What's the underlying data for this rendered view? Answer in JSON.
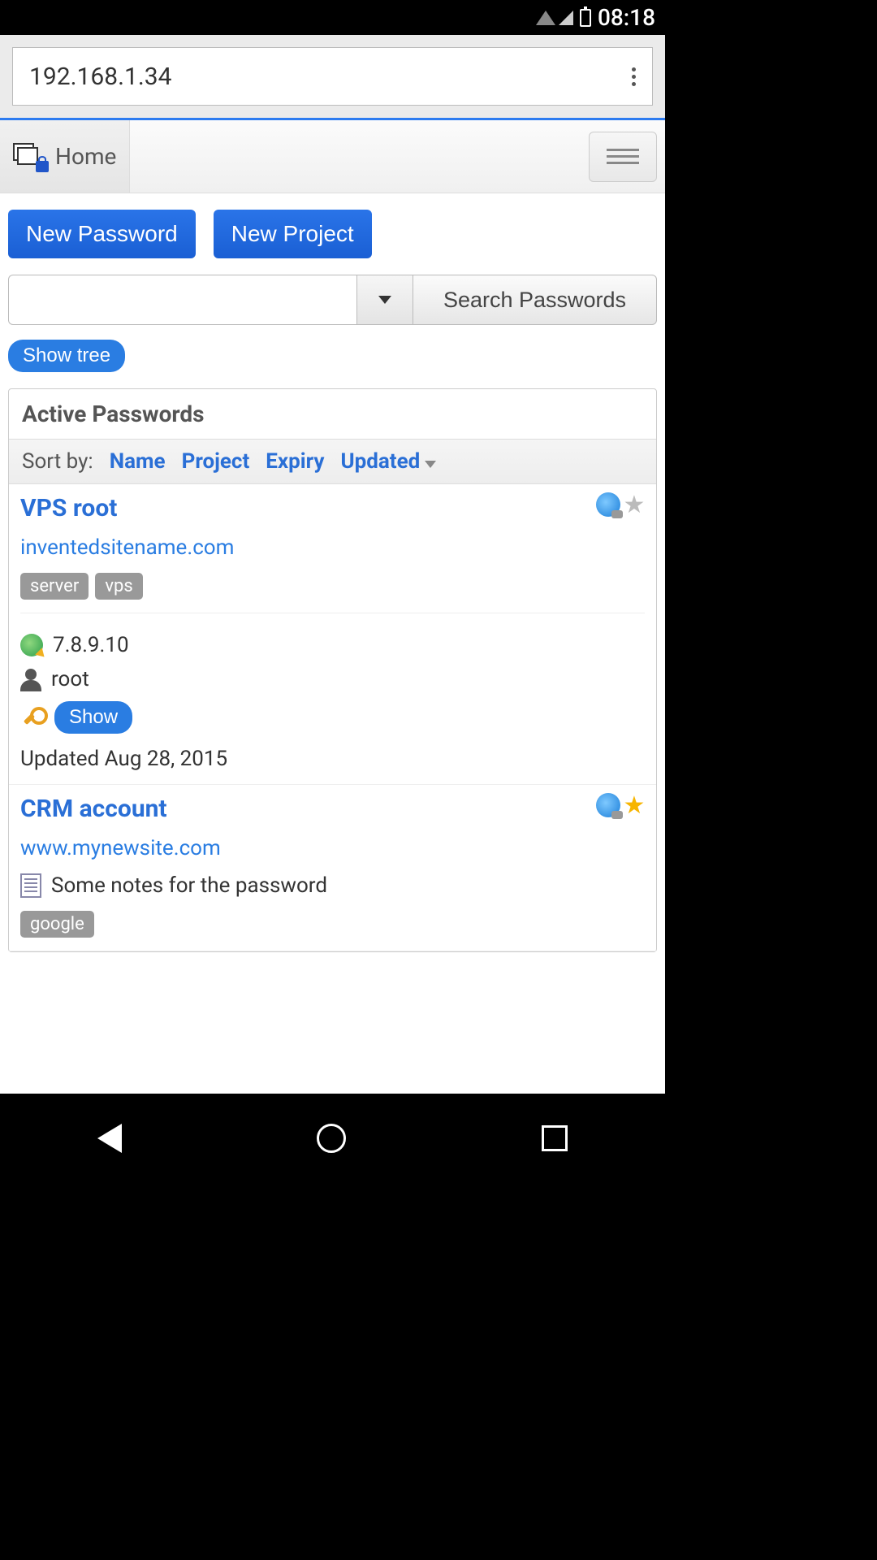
{
  "status": {
    "time": "08:18"
  },
  "browser": {
    "url": "192.168.1.34"
  },
  "nav": {
    "home_label": "Home"
  },
  "actions": {
    "new_password": "New Password",
    "new_project": "New Project",
    "search_button": "Search Passwords",
    "show_tree": "Show tree"
  },
  "panel": {
    "title": "Active Passwords",
    "sort_label": "Sort by:",
    "sort_options": {
      "name": "Name",
      "project": "Project",
      "expiry": "Expiry",
      "updated": "Updated"
    }
  },
  "entries": [
    {
      "title": "VPS root",
      "url": "inventedsitename.com",
      "tags": [
        "server",
        "vps"
      ],
      "ip": "7.8.9.10",
      "user": "root",
      "show_label": "Show",
      "updated": "Updated Aug 28, 2015",
      "starred": false
    },
    {
      "title": "CRM account",
      "url": "www.mynewsite.com",
      "note": "Some notes for the password",
      "tags": [
        "google"
      ],
      "starred": true
    }
  ]
}
